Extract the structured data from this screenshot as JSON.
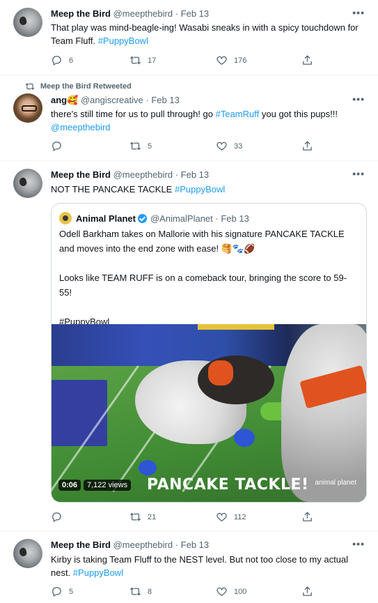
{
  "tweets": [
    {
      "name": "Meep the Bird",
      "handle": "@meepthebird",
      "sep": "·",
      "date": "Feb 13",
      "text": "That play was mind-beagle-ing! Wasabi sneaks in with a spicy touchdown for Team Fluff.",
      "hashtag": "#PuppyBowl",
      "replies": "6",
      "retweets": "17",
      "likes": "176"
    },
    {
      "retweeted_by": "Meep the Bird Retweeted",
      "name": "ang🥰",
      "handle": "@angiscreative",
      "sep": "·",
      "date": "Feb 13",
      "text_before": "there's still time for us to pull through! go",
      "hashtag": "#TeamRuff",
      "text_after": "you got this pups!!!",
      "mention": "@meepthebird",
      "replies": "",
      "retweets": "5",
      "likes": "33"
    },
    {
      "name": "Meep the Bird",
      "handle": "@meepthebird",
      "sep": "·",
      "date": "Feb 13",
      "text": "NOT THE PANCAKE TACKLE",
      "hashtag": "#PuppyBowl",
      "quote": {
        "name": "Animal Planet",
        "handle": "@AnimalPlanet",
        "sep": "·",
        "date": "Feb 13",
        "line1": "Odell Barkham takes on Mallorie with his signature PANCAKE TACKLE and moves into the end zone with ease! 🥞🐾🏈",
        "line2": "Looks like TEAM RUFF is on a comeback tour, bringing the score to 59-55!",
        "line3": "#PuppyBowl",
        "video": {
          "caption": "PANCAKE TACKLE!",
          "time": "0:06",
          "views": "7,122 views",
          "logo": "animal planet"
        }
      },
      "replies": "",
      "retweets": "21",
      "likes": "112"
    },
    {
      "name": "Meep the Bird",
      "handle": "@meepthebird",
      "sep": "·",
      "date": "Feb 13",
      "text": "Kirby is taking Team Fluff to the NEST level. But not too close to my actual nest.",
      "hashtag": "#PuppyBowl",
      "replies": "5",
      "retweets": "8",
      "likes": "100"
    }
  ],
  "more_glyph": "•••",
  "icons": {
    "reply": "reply-icon",
    "retweet": "retweet-icon",
    "like": "heart-icon",
    "share": "share-icon",
    "more": "more-icon",
    "verified": "verified-badge-icon"
  },
  "colors": {
    "link": "#1d9bf0",
    "secondary_text": "#536471",
    "primary_text": "#0f1419",
    "divider": "#eff3f4"
  }
}
